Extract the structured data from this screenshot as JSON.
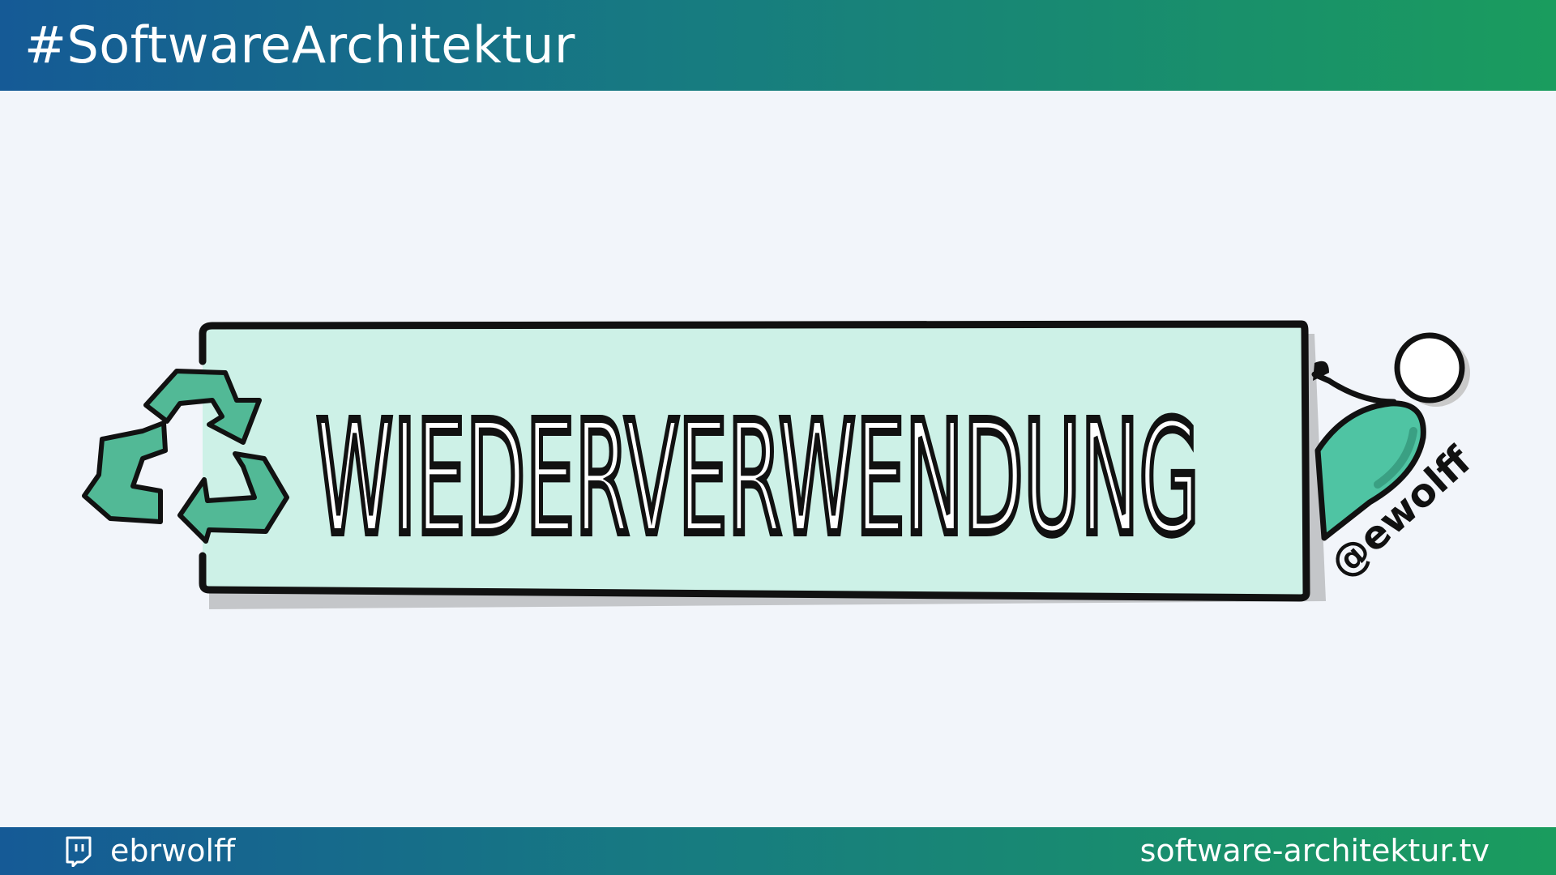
{
  "header": {
    "title": "#SoftwareArchitektur"
  },
  "sketch": {
    "word": "WIEDERVERWENDUNG",
    "handle": "@ewolff",
    "icon": "recycle-icon",
    "figure": "person-figure"
  },
  "footer": {
    "channel_icon": "twitch-icon",
    "channel_name": "ebrwolff",
    "url": "software-architektur.tv"
  },
  "colors": {
    "gradient_start": "#155a96",
    "gradient_end": "#1a9c5e",
    "sketch_fill": "#cdf1e7",
    "accent_green": "#4fc4a3",
    "background": "#f2f5fa"
  }
}
